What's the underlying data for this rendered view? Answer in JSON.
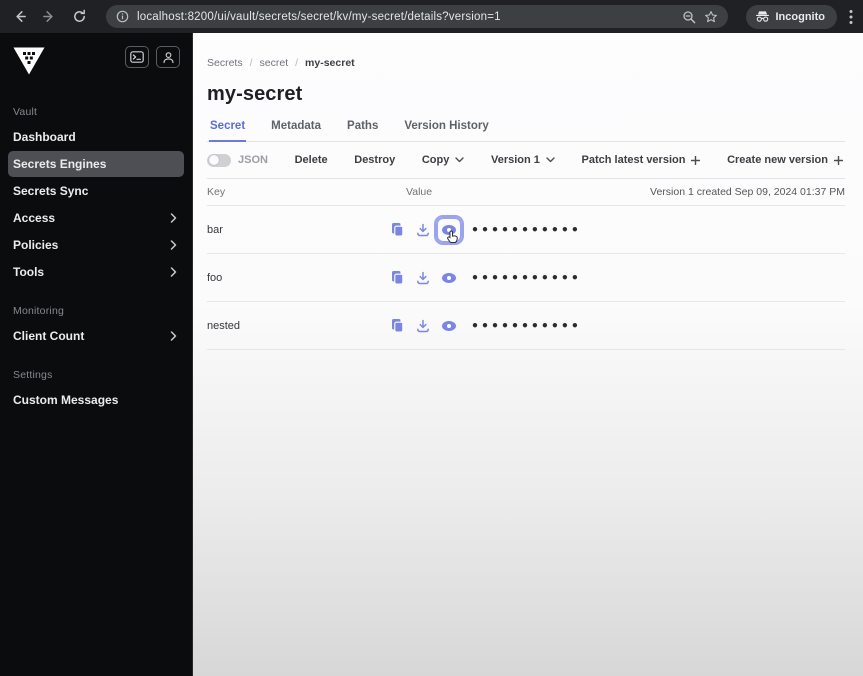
{
  "colors": {
    "accent": "#6b7ade",
    "chrome_bg": "#202124",
    "omnibox_bg": "#3c4043",
    "sidebar_bg": "#0b0c0e",
    "sidebar_selected_bg": "#4d4f54",
    "content_bg": "#fbfbfc",
    "icon_accent": "#7b86e4"
  },
  "browser": {
    "url": "localhost:8200/ui/vault/secrets/secret/kv/my-secret/details?version=1",
    "incognito_label": "Incognito"
  },
  "sidebar": {
    "sections": [
      {
        "label": "Vault",
        "items": [
          {
            "label": "Dashboard"
          },
          {
            "label": "Secrets Engines"
          },
          {
            "label": "Secrets Sync"
          },
          {
            "label": "Access"
          },
          {
            "label": "Policies"
          },
          {
            "label": "Tools"
          }
        ]
      },
      {
        "label": "Monitoring",
        "items": [
          {
            "label": "Client Count"
          }
        ]
      },
      {
        "label": "Settings",
        "items": [
          {
            "label": "Custom Messages"
          }
        ]
      }
    ]
  },
  "breadcrumb": {
    "items": [
      "Secrets",
      "secret",
      "my-secret"
    ],
    "separator": "/"
  },
  "page": {
    "title": "my-secret"
  },
  "tabs": [
    {
      "label": "Secret"
    },
    {
      "label": "Metadata"
    },
    {
      "label": "Paths"
    },
    {
      "label": "Version History"
    }
  ],
  "toolbar": {
    "json_toggle_label": "JSON",
    "delete_label": "Delete",
    "destroy_label": "Destroy",
    "copy_label": "Copy",
    "version_label": "Version 1",
    "patch_label": "Patch latest version",
    "create_label": "Create new version"
  },
  "secret_table": {
    "key_header": "Key",
    "value_header": "Value",
    "version_info": "Version 1 created Sep 09, 2024 01:37 PM",
    "rows": [
      {
        "key": "bar",
        "masked_value": "•••••••••••"
      },
      {
        "key": "foo",
        "masked_value": "•••••••••••"
      },
      {
        "key": "nested",
        "masked_value": "•••••••••••"
      }
    ]
  }
}
